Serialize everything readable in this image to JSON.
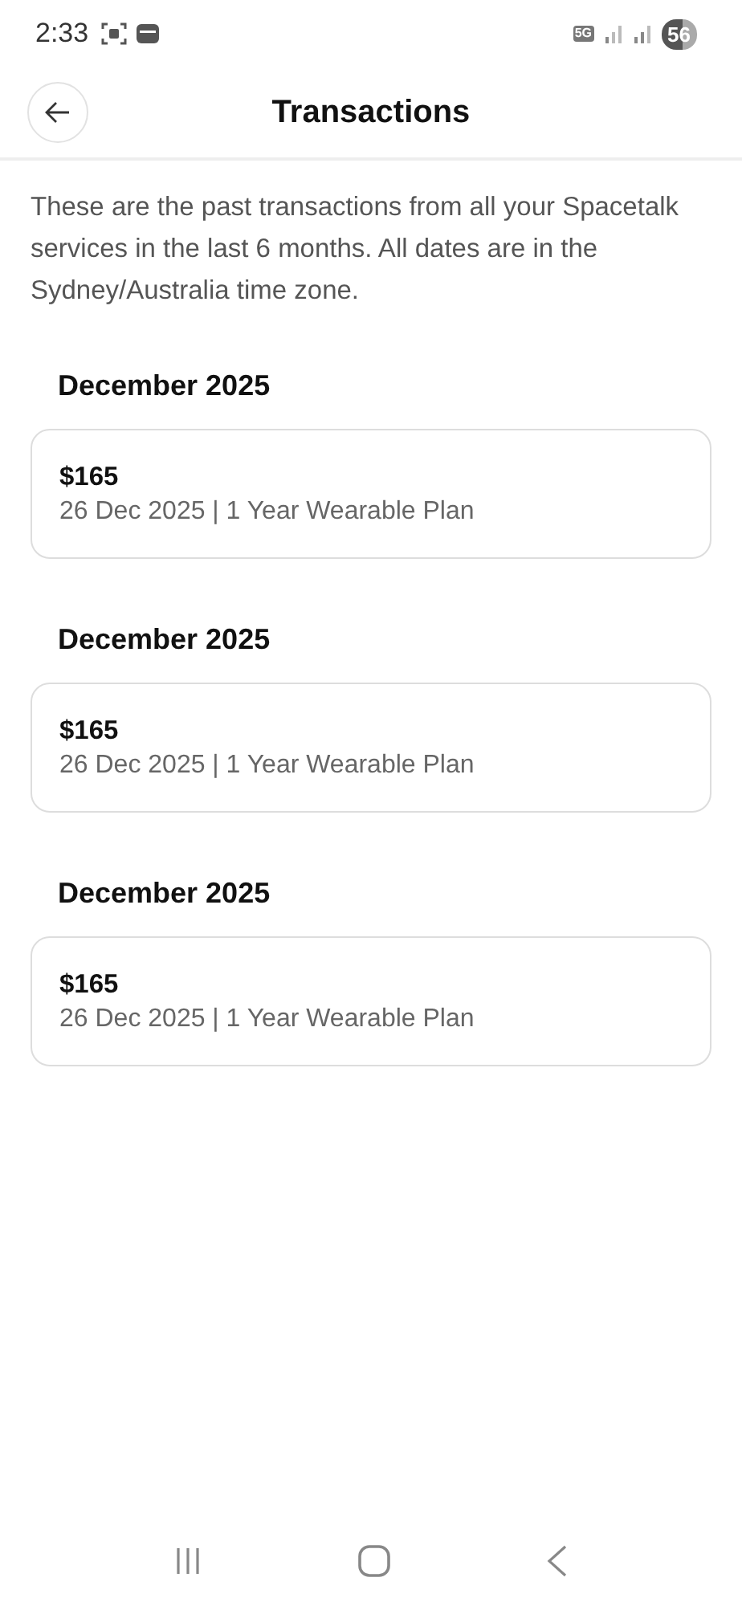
{
  "status_bar": {
    "time": "2:33",
    "network": "5G",
    "battery": "56"
  },
  "header": {
    "title": "Transactions"
  },
  "description": "These are the past transactions from all your Spacetalk services in the last 6 months. All dates are in the Sydney/Australia time zone.",
  "sections": [
    {
      "heading": "December 2025",
      "transactions": [
        {
          "amount": "$165",
          "detail": "26 Dec 2025 | 1 Year Wearable Plan"
        }
      ]
    },
    {
      "heading": "December 2025",
      "transactions": [
        {
          "amount": "$165",
          "detail": "26 Dec 2025 | 1 Year Wearable Plan"
        }
      ]
    },
    {
      "heading": "December 2025",
      "transactions": [
        {
          "amount": "$165",
          "detail": "26 Dec 2025 | 1 Year Wearable Plan"
        }
      ]
    }
  ]
}
